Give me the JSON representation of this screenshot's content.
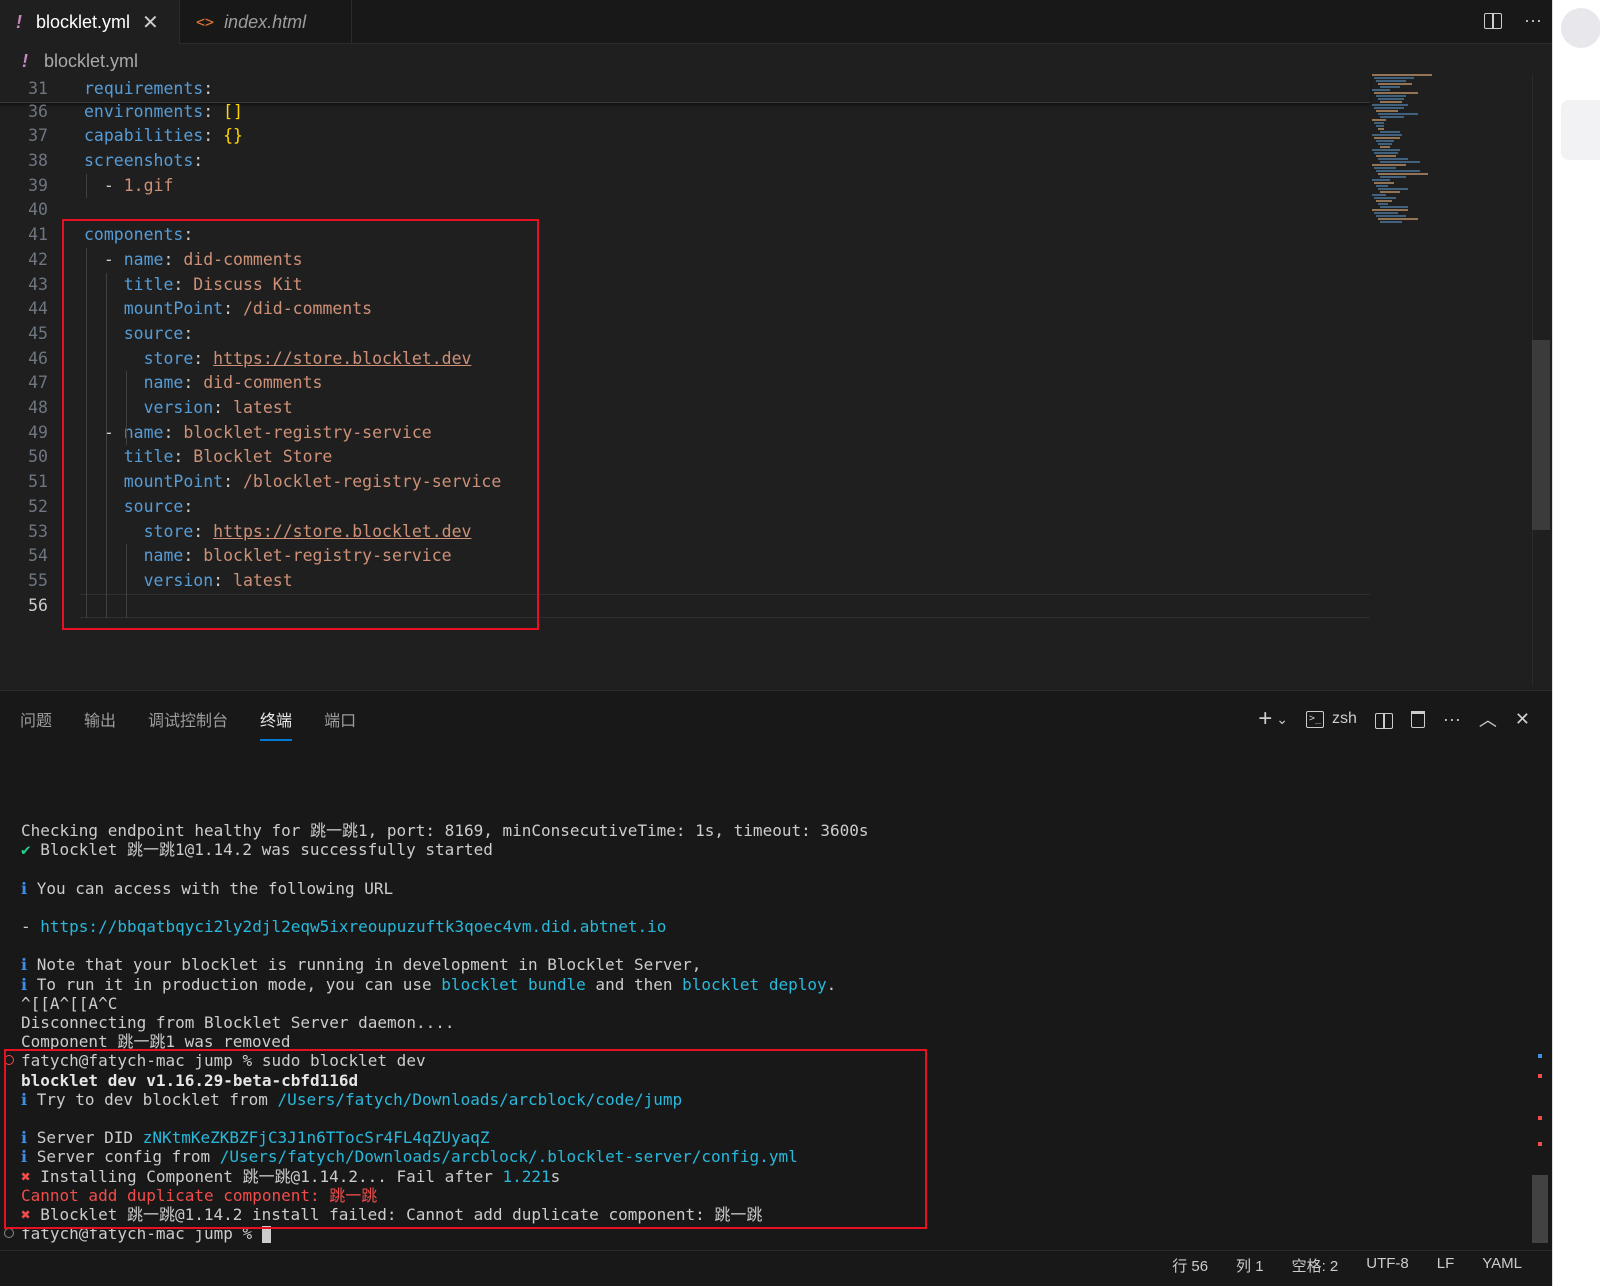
{
  "tabs": [
    {
      "label": "blocklet.yml",
      "icon": "yaml-exclamation-icon",
      "active": true
    },
    {
      "label": "index.html",
      "icon": "html-brackets-icon",
      "active": false
    }
  ],
  "tab_marks": {
    "yaml": "!",
    "html": "<>",
    "close": "✕",
    "more": "···"
  },
  "breadcrumb": {
    "file": "blocklet.yml"
  },
  "editor": {
    "lines": [
      {
        "n": "31",
        "seg": [
          [
            "k",
            "requirements"
          ],
          [
            "p",
            ":"
          ]
        ]
      },
      {
        "n": "36",
        "seg": [
          [
            "k",
            "environments"
          ],
          [
            "p",
            ": "
          ],
          [
            "b",
            "[]"
          ]
        ]
      },
      {
        "n": "37",
        "seg": [
          [
            "k",
            "capabilities"
          ],
          [
            "p",
            ": "
          ],
          [
            "b",
            "{}"
          ]
        ]
      },
      {
        "n": "38",
        "seg": [
          [
            "k",
            "screenshots"
          ],
          [
            "p",
            ":"
          ]
        ]
      },
      {
        "n": "39",
        "seg": [
          [
            "p",
            "  - "
          ],
          [
            "v",
            "1.gif"
          ]
        ]
      },
      {
        "n": "40",
        "seg": []
      },
      {
        "n": "41",
        "seg": [
          [
            "k",
            "components"
          ],
          [
            "p",
            ":"
          ]
        ]
      },
      {
        "n": "42",
        "seg": [
          [
            "p",
            "  - "
          ],
          [
            "k",
            "name"
          ],
          [
            "p",
            ": "
          ],
          [
            "v",
            "did-comments"
          ]
        ]
      },
      {
        "n": "43",
        "seg": [
          [
            "p",
            "    "
          ],
          [
            "k",
            "title"
          ],
          [
            "p",
            ": "
          ],
          [
            "v",
            "Discuss Kit"
          ]
        ]
      },
      {
        "n": "44",
        "seg": [
          [
            "p",
            "    "
          ],
          [
            "k",
            "mountPoint"
          ],
          [
            "p",
            ": "
          ],
          [
            "v",
            "/did-comments"
          ]
        ]
      },
      {
        "n": "45",
        "seg": [
          [
            "p",
            "    "
          ],
          [
            "k",
            "source"
          ],
          [
            "p",
            ":"
          ]
        ]
      },
      {
        "n": "46",
        "seg": [
          [
            "p",
            "      "
          ],
          [
            "k",
            "store"
          ],
          [
            "p",
            ": "
          ],
          [
            "link",
            "https://store.blocklet.dev"
          ]
        ]
      },
      {
        "n": "47",
        "seg": [
          [
            "p",
            "      "
          ],
          [
            "k",
            "name"
          ],
          [
            "p",
            ": "
          ],
          [
            "v",
            "did-comments"
          ]
        ]
      },
      {
        "n": "48",
        "seg": [
          [
            "p",
            "      "
          ],
          [
            "k",
            "version"
          ],
          [
            "p",
            ": "
          ],
          [
            "v",
            "latest"
          ]
        ]
      },
      {
        "n": "49",
        "seg": [
          [
            "p",
            "  - "
          ],
          [
            "k",
            "name"
          ],
          [
            "p",
            ": "
          ],
          [
            "v",
            "blocklet-registry-service"
          ]
        ]
      },
      {
        "n": "50",
        "seg": [
          [
            "p",
            "    "
          ],
          [
            "k",
            "title"
          ],
          [
            "p",
            ": "
          ],
          [
            "v",
            "Blocklet Store"
          ]
        ]
      },
      {
        "n": "51",
        "seg": [
          [
            "p",
            "    "
          ],
          [
            "k",
            "mountPoint"
          ],
          [
            "p",
            ": "
          ],
          [
            "v",
            "/blocklet-registry-service"
          ]
        ]
      },
      {
        "n": "52",
        "seg": [
          [
            "p",
            "    "
          ],
          [
            "k",
            "source"
          ],
          [
            "p",
            ":"
          ]
        ]
      },
      {
        "n": "53",
        "seg": [
          [
            "p",
            "      "
          ],
          [
            "k",
            "store"
          ],
          [
            "p",
            ": "
          ],
          [
            "link",
            "https://store.blocklet.dev"
          ]
        ]
      },
      {
        "n": "54",
        "seg": [
          [
            "p",
            "      "
          ],
          [
            "k",
            "name"
          ],
          [
            "p",
            ": "
          ],
          [
            "v",
            "blocklet-registry-service"
          ]
        ]
      },
      {
        "n": "55",
        "seg": [
          [
            "p",
            "      "
          ],
          [
            "k",
            "version"
          ],
          [
            "p",
            ": "
          ],
          [
            "v",
            "latest"
          ]
        ]
      },
      {
        "n": "56",
        "seg": [],
        "current": true
      }
    ]
  },
  "panel": {
    "tabs": [
      {
        "label": "问题",
        "active": false
      },
      {
        "label": "输出",
        "active": false
      },
      {
        "label": "调试控制台",
        "active": false
      },
      {
        "label": "终端",
        "active": true
      },
      {
        "label": "端口",
        "active": false
      }
    ],
    "shell": "zsh",
    "plus": "+",
    "chevron": "⌄",
    "more": "···",
    "maximize": "︿",
    "close": "✕"
  },
  "terminal": {
    "lines": [
      {
        "seg": [
          [
            "n",
            "Checking endpoint healthy for 跳一跳1, port: 8169, minConsecutiveTime: 1s, timeout: 3600s"
          ]
        ]
      },
      {
        "seg": [
          [
            "g",
            "✔ "
          ],
          [
            "n",
            "Blocklet 跳一跳1@1.14.2 was successfully started"
          ]
        ]
      },
      {
        "seg": []
      },
      {
        "seg": [
          [
            "i",
            "ℹ "
          ],
          [
            "n",
            "You can access with the following URL"
          ]
        ]
      },
      {
        "seg": []
      },
      {
        "seg": [
          [
            "n",
            "- "
          ],
          [
            "u",
            "https://bbqatbqyci2ly2djl2eqw5ixreoupuzuftk3qoec4vm.did.abtnet.io"
          ]
        ]
      },
      {
        "seg": []
      },
      {
        "seg": [
          [
            "i",
            "ℹ "
          ],
          [
            "n",
            "Note that your blocklet is running in development in Blocklet Server,"
          ]
        ]
      },
      {
        "seg": [
          [
            "i",
            "ℹ "
          ],
          [
            "n",
            "To run it in production mode, you can use "
          ],
          [
            "u",
            "blocklet bundle"
          ],
          [
            "n",
            " and then "
          ],
          [
            "u",
            "blocklet deploy"
          ],
          [
            "n",
            "."
          ]
        ]
      },
      {
        "seg": [
          [
            "n",
            "^[[A^[[A^C"
          ]
        ]
      },
      {
        "seg": [
          [
            "n",
            "Disconnecting from Blocklet Server daemon...."
          ]
        ]
      },
      {
        "seg": [
          [
            "n",
            "Component 跳一跳1 was removed"
          ]
        ]
      },
      {
        "seg": [
          [
            "n",
            "fatych@fatych-mac jump % sudo blocklet dev"
          ]
        ],
        "dot": "red"
      },
      {
        "seg": [
          [
            "bold",
            "blocklet dev v1.16.29-beta-cbfd116d"
          ]
        ]
      },
      {
        "seg": [
          [
            "i",
            "ℹ "
          ],
          [
            "n",
            "Try to dev blocklet from "
          ],
          [
            "u",
            "/Users/fatych/Downloads/arcblock/code/jump"
          ]
        ]
      },
      {
        "seg": []
      },
      {
        "seg": [
          [
            "i",
            "ℹ "
          ],
          [
            "n",
            "Server DID "
          ],
          [
            "u",
            "zNKtmKeZKBZFjC3J1n6TTocSr4FL4qZUyaqZ"
          ]
        ]
      },
      {
        "seg": [
          [
            "i",
            "ℹ "
          ],
          [
            "n",
            "Server config from "
          ],
          [
            "u",
            "/Users/fatych/Downloads/arcblock/.blocklet-server/config.yml"
          ]
        ]
      },
      {
        "seg": [
          [
            "r",
            "✖ "
          ],
          [
            "n",
            "Installing Component 跳一跳@1.14.2... Fail after "
          ],
          [
            "u",
            "1.221"
          ],
          [
            "n",
            "s"
          ]
        ]
      },
      {
        "seg": [
          [
            "r",
            "Cannot add duplicate component: 跳一跳"
          ]
        ]
      },
      {
        "seg": [
          [
            "r",
            "✖ "
          ],
          [
            "n",
            "Blocklet 跳一跳@1.14.2 install failed: Cannot add duplicate component: 跳一跳"
          ]
        ]
      },
      {
        "seg": [
          [
            "n",
            "fatych@fatych-mac jump % "
          ],
          [
            "cursor",
            ""
          ]
        ],
        "dot": "grey"
      }
    ]
  },
  "statusbar": {
    "items": [
      "行 56",
      "列 1",
      "空格: 2",
      "UTF-8",
      "LF",
      "YAML"
    ]
  },
  "colors": {
    "accent": "#0078d4",
    "highlight_box": "#e81123",
    "yaml_key": "#569cd6",
    "yaml_value": "#ce9178"
  }
}
